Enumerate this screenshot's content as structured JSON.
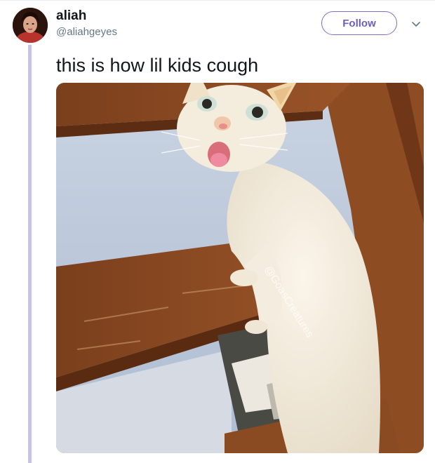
{
  "tweet": {
    "author": {
      "display_name": "aliah",
      "handle": "@aliahgeyes"
    },
    "follow_label": "Follow",
    "text": "this is how lil kids cough",
    "media": {
      "watermark": "@GoasCreatures",
      "description_icon": "cat-photo"
    }
  },
  "icons": {
    "caret": "chevron-down-icon",
    "avatar": "avatar"
  },
  "colors": {
    "follow_border": "#7c6fc6",
    "thread_line": "#c9c3e8",
    "handle_text": "#657786"
  }
}
